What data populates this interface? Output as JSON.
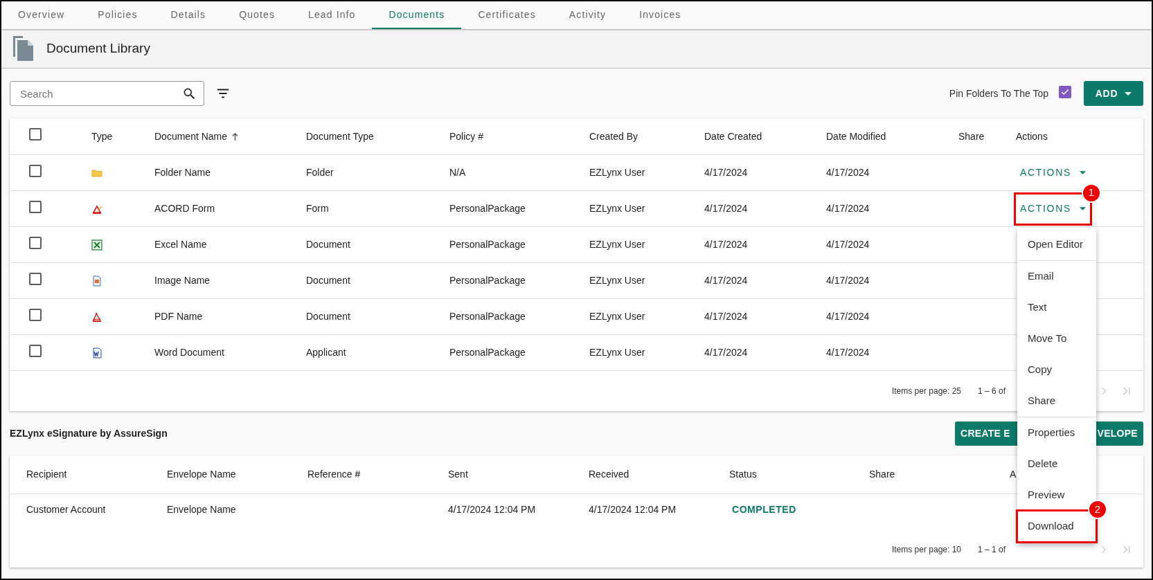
{
  "tabs": [
    {
      "label": "Overview",
      "selected": false
    },
    {
      "label": "Policies",
      "selected": false
    },
    {
      "label": "Details",
      "selected": false
    },
    {
      "label": "Quotes",
      "selected": false
    },
    {
      "label": "Lead Info",
      "selected": false
    },
    {
      "label": "Documents",
      "selected": true
    },
    {
      "label": "Certificates",
      "selected": false
    },
    {
      "label": "Activity",
      "selected": false
    },
    {
      "label": "Invoices",
      "selected": false
    }
  ],
  "header": {
    "title": "Document Library"
  },
  "toolbar": {
    "search": {
      "placeholder": "Search"
    },
    "pin": {
      "label": "Pin Folders To The Top",
      "checked": true
    },
    "add_button": "ADD"
  },
  "documents": {
    "select_all": {
      "checked": false
    },
    "columns": [
      {
        "label": "Type",
        "sorted": false
      },
      {
        "label": "Document Name",
        "sorted": true
      },
      {
        "label": "Document Type",
        "sorted": false
      },
      {
        "label": "Policy #",
        "sorted": false
      },
      {
        "label": "Created By",
        "sorted": false
      },
      {
        "label": "Date Created",
        "sorted": false
      },
      {
        "label": "Date Modified",
        "sorted": false
      },
      {
        "label": "Share",
        "sorted": false
      },
      {
        "label": "Actions",
        "sorted": false
      }
    ],
    "rows": [
      {
        "checked": false,
        "kind": "folder",
        "name": "Folder Name",
        "document_type": "Folder",
        "policy": "N/A",
        "created_by": "EZLynx User",
        "date_created": "4/17/2024",
        "date_modified": "4/17/2024",
        "actions": "ACTIONS"
      },
      {
        "checked": false,
        "kind": "acord",
        "name": "ACORD Form",
        "document_type": "Form",
        "policy": "PersonalPackage",
        "created_by": "EZLynx User",
        "date_created": "4/17/2024",
        "date_modified": "4/17/2024",
        "actions": "ACTIONS",
        "callout": "1"
      },
      {
        "checked": false,
        "kind": "excel",
        "name": "Excel Name",
        "document_type": "Document",
        "policy": "PersonalPackage",
        "created_by": "EZLynx User",
        "date_created": "4/17/2024",
        "date_modified": "4/17/2024"
      },
      {
        "checked": false,
        "kind": "image",
        "name": "Image Name",
        "document_type": "Document",
        "policy": "PersonalPackage",
        "created_by": "EZLynx User",
        "date_created": "4/17/2024",
        "date_modified": "4/17/2024"
      },
      {
        "checked": false,
        "kind": "pdf",
        "name": "PDF Name",
        "document_type": "Document",
        "policy": "PersonalPackage",
        "created_by": "EZLynx User",
        "date_created": "4/17/2024",
        "date_modified": "4/17/2024"
      },
      {
        "checked": false,
        "kind": "word",
        "name": "Word Document",
        "document_type": "Applicant",
        "policy": "PersonalPackage",
        "created_by": "EZLynx User",
        "date_created": "4/17/2024",
        "date_modified": "4/17/2024"
      }
    ],
    "pagination": {
      "items_per_page": "Items per page: 25",
      "range": "1 – 6 of"
    }
  },
  "menu": {
    "groups": [
      [
        {
          "label": "Open Editor"
        }
      ],
      [
        {
          "label": "Email"
        },
        {
          "label": "Text"
        },
        {
          "label": "Move To"
        },
        {
          "label": "Copy"
        },
        {
          "label": "Share"
        }
      ],
      [
        {
          "label": "Properties"
        },
        {
          "label": "Delete"
        },
        {
          "label": "Preview"
        },
        {
          "label": "Download",
          "callout": "2"
        }
      ]
    ]
  },
  "esignature": {
    "title": "EZLynx eSignature by AssureSign",
    "create_button": {
      "visible_start": "CREATE E",
      "visible_end": "VELOPE"
    },
    "columns": [
      "Recipient",
      "Envelope Name",
      "Reference #",
      "Sent",
      "Received",
      "Status",
      "Share",
      "A"
    ],
    "rows": [
      {
        "recipient": "Customer Account",
        "envelope_name": "Envelope Name",
        "sent": "4/17/2024 12:04 PM",
        "received": "4/17/2024 12:04 PM",
        "status": "COMPLETED"
      }
    ],
    "pagination": {
      "items_per_page": "Items per page: 10",
      "range": "1 – 1 of"
    }
  }
}
